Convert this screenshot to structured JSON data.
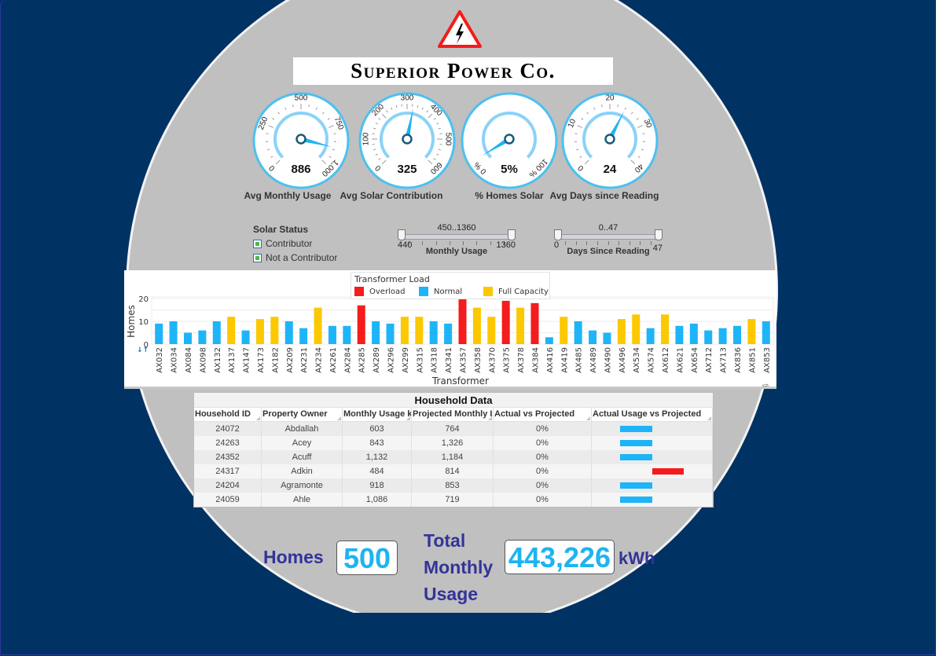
{
  "brand": {
    "title": "Superior Power Co.",
    "logo_icon": "high-voltage-warning-icon"
  },
  "gauges": [
    {
      "label": "Avg Monthly Usage",
      "value": 886,
      "display": "886",
      "min": 0,
      "max": 1000,
      "ticks": [
        "0",
        "250",
        "500",
        "750",
        "1,000"
      ]
    },
    {
      "label": "Avg Solar Contribution",
      "value": 325,
      "display": "325",
      "min": 0,
      "max": 600,
      "ticks": [
        "0",
        "100",
        "200",
        "300",
        "400",
        "500",
        "600"
      ]
    },
    {
      "label": "% Homes Solar",
      "value": 5,
      "display": "5%",
      "min": 0,
      "max": 100,
      "ticks": [
        "0 %",
        "100 %"
      ]
    },
    {
      "label": "Avg Days since Reading",
      "value": 24,
      "display": "24",
      "min": 0,
      "max": 40,
      "ticks": [
        "0",
        "10",
        "20",
        "30",
        "40"
      ]
    }
  ],
  "filters": {
    "solar_status": {
      "title": "Solar Status",
      "options": [
        {
          "label": "Contributor",
          "checked": true
        },
        {
          "label": "Not a Contributor",
          "checked": true
        }
      ]
    },
    "monthly_usage": {
      "title": "Monthly Usage",
      "range": "450..1360",
      "min": "440",
      "max": "1360",
      "low": 450,
      "high": 1360,
      "lo_bound": 440,
      "hi_bound": 1360
    },
    "days_since_reading": {
      "title": "Days Since Reading",
      "range": "0..47",
      "min": "0",
      "max": "47",
      "low": 0,
      "high": 47,
      "lo_bound": 0,
      "hi_bound": 47
    }
  },
  "chart_data": {
    "type": "bar",
    "title": "",
    "xlabel": "Transformer",
    "ylabel": "Homes",
    "ylim": [
      0,
      20
    ],
    "yticks": [
      "0",
      "10",
      "20"
    ],
    "grid": true,
    "legend": {
      "title": "Transformer Load",
      "placement": "top-center",
      "entries": [
        {
          "name": "Overload",
          "color": "#f41c1c"
        },
        {
          "name": "Normal",
          "color": "#1eb4f8"
        },
        {
          "name": "Full Capacity",
          "color": "#fcc800"
        }
      ]
    },
    "categories": [
      "AX032",
      "AX034",
      "AX084",
      "AX098",
      "AX132",
      "AX137",
      "AX147",
      "AX173",
      "AX182",
      "AX209",
      "AX231",
      "AX234",
      "AX261",
      "AX284",
      "AX285",
      "AX289",
      "AX296",
      "AX299",
      "AX315",
      "AX318",
      "AX341",
      "AX357",
      "AX358",
      "AX370",
      "AX375",
      "AX378",
      "AX384",
      "AX416",
      "AX419",
      "AX485",
      "AX489",
      "AX490",
      "AX496",
      "AX534",
      "AX574",
      "AX612",
      "AX621",
      "AX654",
      "AX712",
      "AX713",
      "AX836",
      "AX851",
      "AX853"
    ],
    "values": [
      9,
      10,
      5,
      6,
      10,
      12,
      6,
      11,
      12,
      10,
      7,
      16,
      8,
      8,
      17,
      10,
      9,
      12,
      12,
      10,
      9,
      20,
      16,
      12,
      19,
      16,
      18,
      3,
      12,
      10,
      6,
      5,
      11,
      13,
      7,
      13,
      8,
      9,
      6,
      7,
      8,
      11,
      10
    ],
    "load": [
      "Normal",
      "Normal",
      "Normal",
      "Normal",
      "Normal",
      "Full Capacity",
      "Normal",
      "Full Capacity",
      "Full Capacity",
      "Normal",
      "Normal",
      "Full Capacity",
      "Normal",
      "Normal",
      "Overload",
      "Normal",
      "Normal",
      "Full Capacity",
      "Full Capacity",
      "Normal",
      "Normal",
      "Overload",
      "Full Capacity",
      "Full Capacity",
      "Overload",
      "Full Capacity",
      "Overload",
      "Normal",
      "Full Capacity",
      "Normal",
      "Normal",
      "Normal",
      "Full Capacity",
      "Full Capacity",
      "Normal",
      "Full Capacity",
      "Normal",
      "Normal",
      "Normal",
      "Normal",
      "Normal",
      "Full Capacity",
      "Normal"
    ],
    "sort_icon": "sort-icon",
    "scroll_icon": "scroll-right-arrow-icon"
  },
  "household_table": {
    "title": "Household Data",
    "columns": [
      "Household ID",
      "Property Owner",
      "Monthly Usage k",
      "Projected Monthly I",
      "Actual vs Projected",
      "Actual Usage vs Projected"
    ],
    "rows": [
      {
        "id": "24072",
        "owner": "Abdallah",
        "usage": "603",
        "projected": "764",
        "pct": "0%",
        "direction": "under"
      },
      {
        "id": "24263",
        "owner": "Acey",
        "usage": "843",
        "projected": "1,326",
        "pct": "0%",
        "direction": "under"
      },
      {
        "id": "24352",
        "owner": "Acuff",
        "usage": "1,132",
        "projected": "1,184",
        "pct": "0%",
        "direction": "under"
      },
      {
        "id": "24317",
        "owner": "Adkin",
        "usage": "484",
        "projected": "814",
        "pct": "0%",
        "direction": "over"
      },
      {
        "id": "24204",
        "owner": "Agramonte",
        "usage": "918",
        "projected": "853",
        "pct": "0%",
        "direction": "under"
      },
      {
        "id": "24059",
        "owner": "Ahle",
        "usage": "1,086",
        "projected": "719",
        "pct": "0%",
        "direction": "under"
      }
    ]
  },
  "summary": {
    "homes_label": "Homes",
    "homes_value": "500",
    "total_label_1": "Total",
    "total_label_2": "Monthly",
    "total_label_3": "Usage",
    "total_value": "443,226",
    "unit": "kWh"
  },
  "colors": {
    "background": "#003264",
    "disc": "#c0c0c0",
    "accent": "#1eb4f0",
    "overload": "#f41c1c",
    "normal": "#1eb4f8",
    "full_capacity": "#fcc800",
    "summary_label": "#333399"
  }
}
